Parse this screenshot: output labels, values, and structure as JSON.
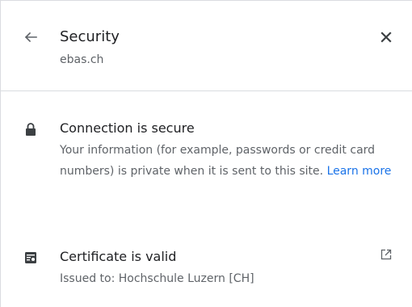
{
  "header": {
    "title": "Security",
    "site": "ebas.ch",
    "back_icon": "arrow-back-icon",
    "close_icon": "close-icon"
  },
  "connection": {
    "icon": "lock-icon",
    "title": "Connection is secure",
    "description": "Your information (for example, passwords or credit card numbers) is private when it is sent to this site.",
    "learn_more": "Learn more"
  },
  "certificate": {
    "icon": "certificate-icon",
    "title": "Certificate is valid",
    "issued_to": "Issued to: Hochschule Luzern [CH]",
    "open_icon": "open-in-new-icon"
  },
  "colors": {
    "text": "#202124",
    "secondary": "#5f6368",
    "link": "#1a73e8",
    "divider": "#dadce0"
  }
}
